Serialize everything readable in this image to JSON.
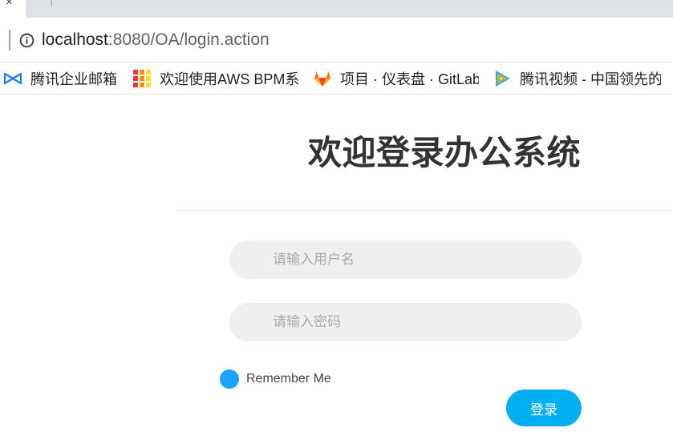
{
  "browser": {
    "tab": {
      "close_glyph": "×"
    },
    "address_bar": {
      "info_icon": "info-icon",
      "url_host": "localhost",
      "url_rest": ":8080/OA/login.action"
    },
    "bookmarks": [
      {
        "label": "腾讯企业邮箱",
        "icon": "tencent-mail-icon"
      },
      {
        "label": "欢迎使用AWS BPM系",
        "icon": "aws-grid-icon"
      },
      {
        "label": "项目 · 仪表盘 · GitLab",
        "icon": "gitlab-icon"
      },
      {
        "label": "腾讯视频 - 中国领先的",
        "icon": "tencent-video-icon"
      }
    ]
  },
  "login": {
    "title": "欢迎登录办公系统",
    "username_placeholder": "请输入用户名",
    "password_placeholder": "请输入密码",
    "remember_label": "Remember Me",
    "submit_label": "登录"
  },
  "colors": {
    "accent": "#00b0f0",
    "radio": "#1aa3ff",
    "field_bg": "#efefef"
  }
}
